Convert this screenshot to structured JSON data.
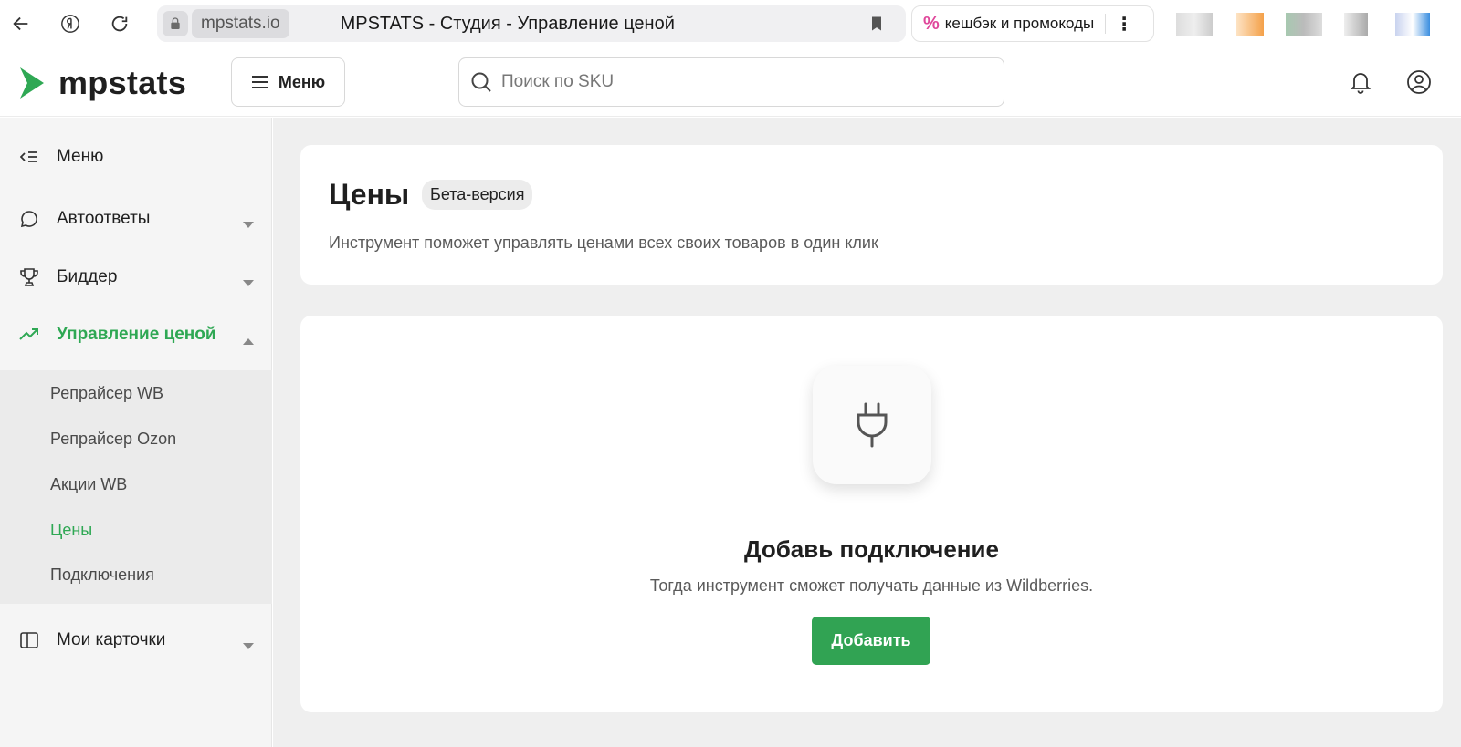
{
  "browser": {
    "domain": "mpstats.io",
    "tab_title": "MPSTATS - Студия - Управление ценой",
    "extension_label": "кешбэк и промокоды"
  },
  "header": {
    "logo_text": "mpstats",
    "menu_button": "Меню",
    "search_placeholder": "Поиск по SKU"
  },
  "sidebar": {
    "collapse_label": "Меню",
    "items": [
      {
        "label": "Автоответы"
      },
      {
        "label": "Биддер"
      },
      {
        "label": "Управление ценой"
      },
      {
        "label": "Мои карточки"
      }
    ],
    "subitems": [
      {
        "label": "Репрайсер WB"
      },
      {
        "label": "Репрайсер Ozon"
      },
      {
        "label": "Акции WB"
      },
      {
        "label": "Цены"
      },
      {
        "label": "Подключения"
      }
    ]
  },
  "page": {
    "title": "Цены",
    "badge": "Бета-версия",
    "description": "Инструмент поможет управлять ценами всех своих товаров в один клик"
  },
  "empty_state": {
    "title": "Добавь подключение",
    "description": "Тогда инструмент сможет получать данные из Wildberries.",
    "button": "Добавить"
  },
  "colors": {
    "accent": "#31a353",
    "active_text": "#2fa854"
  }
}
